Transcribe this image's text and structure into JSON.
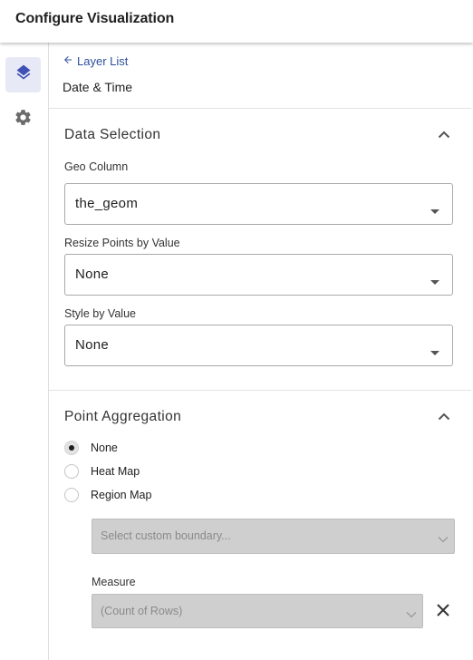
{
  "header": {
    "title": "Configure Visualization"
  },
  "rail": {
    "items": [
      {
        "icon": "layers-icon",
        "active": true
      },
      {
        "icon": "gear-icon",
        "active": false
      }
    ]
  },
  "panel": {
    "back_link": "Layer List",
    "layer_name": "Date & Time",
    "data_selection": {
      "title": "Data Selection",
      "geo_column": {
        "label": "Geo Column",
        "value": "the_geom"
      },
      "resize_points": {
        "label": "Resize Points by Value",
        "value": "None"
      },
      "style_by_value": {
        "label": "Style by Value",
        "value": "None"
      }
    },
    "point_aggregation": {
      "title": "Point Aggregation",
      "options": [
        {
          "label": "None",
          "checked": true
        },
        {
          "label": "Heat Map",
          "checked": false
        },
        {
          "label": "Region Map",
          "checked": false
        }
      ],
      "boundary_placeholder": "Select custom boundary...",
      "measure": {
        "label": "Measure",
        "value": "(Count of Rows)"
      }
    }
  },
  "colors": {
    "accent": "#3f51b5",
    "link": "#2c4f9c",
    "disabled_bg": "#cfcfcf",
    "active_rail_bg": "#e8e9f6"
  }
}
